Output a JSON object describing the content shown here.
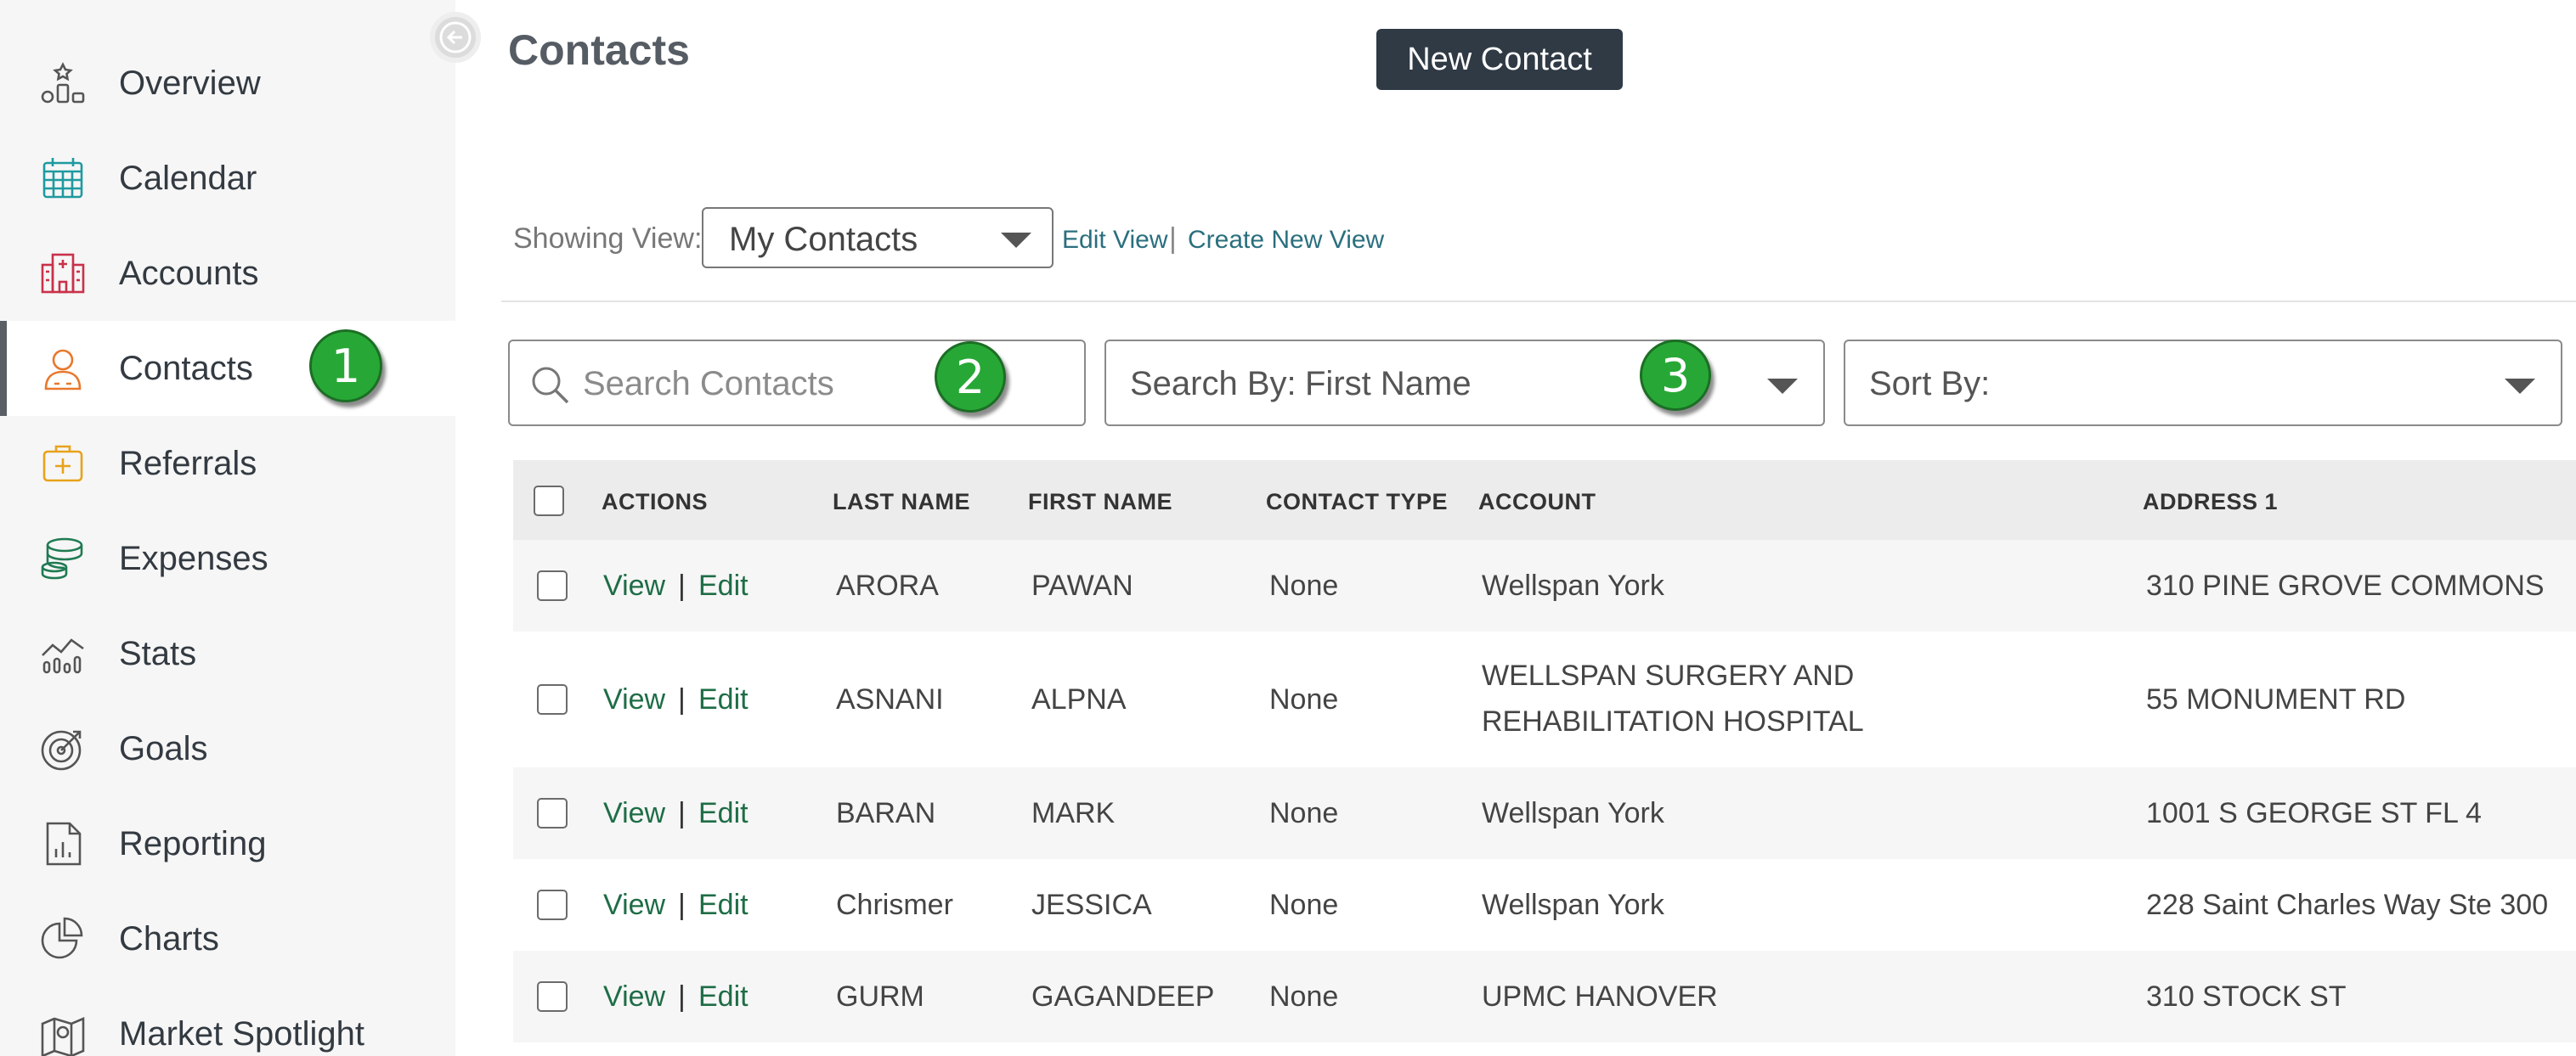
{
  "sidebar": {
    "items": [
      {
        "label": "Overview",
        "icon": "overview-icon"
      },
      {
        "label": "Calendar",
        "icon": "calendar-icon"
      },
      {
        "label": "Accounts",
        "icon": "hospital-icon"
      },
      {
        "label": "Contacts",
        "icon": "person-icon",
        "active": true
      },
      {
        "label": "Referrals",
        "icon": "medkit-icon"
      },
      {
        "label": "Expenses",
        "icon": "coins-icon"
      },
      {
        "label": "Stats",
        "icon": "stats-icon"
      },
      {
        "label": "Goals",
        "icon": "target-icon"
      },
      {
        "label": "Reporting",
        "icon": "report-icon"
      },
      {
        "label": "Charts",
        "icon": "pie-icon"
      },
      {
        "label": "Market Spotlight",
        "icon": "map-icon"
      }
    ]
  },
  "badges": {
    "one": "1",
    "two": "2",
    "three": "3"
  },
  "colors": {
    "accent_green": "#27a836",
    "link": "#1e6d46",
    "dark_button": "#2f3a45"
  },
  "header": {
    "title": "Contacts",
    "new_button": "New Contact"
  },
  "view": {
    "showing_label": "Showing View:",
    "selected": "My Contacts",
    "edit_view": "Edit View",
    "separator": "|",
    "create_view": "Create New View"
  },
  "filters": {
    "search_placeholder": "Search Contacts",
    "search_by_label": "Search By:",
    "search_by_value": "First Name",
    "sort_by_label": "Sort By:"
  },
  "table": {
    "headers": [
      "ACTIONS",
      "LAST NAME",
      "FIRST NAME",
      "CONTACT TYPE",
      "ACCOUNT",
      "ADDRESS 1"
    ],
    "view_label": "View",
    "edit_label": "Edit",
    "pipe": "|",
    "rows": [
      {
        "last": "ARORA",
        "first": "PAWAN",
        "type": "None",
        "account": "Wellspan York",
        "account2": "",
        "address": "310 PINE GROVE COMMONS"
      },
      {
        "last": "ASNANI",
        "first": "ALPNA",
        "type": "None",
        "account": "WELLSPAN SURGERY AND",
        "account2": "REHABILITATION HOSPITAL",
        "address": "55 MONUMENT RD"
      },
      {
        "last": "BARAN",
        "first": "MARK",
        "type": "None",
        "account": "Wellspan York",
        "account2": "",
        "address": "1001 S GEORGE ST FL 4"
      },
      {
        "last": "Chrismer",
        "first": "JESSICA",
        "type": "None",
        "account": "Wellspan York",
        "account2": "",
        "address": "228 Saint Charles Way Ste 300"
      },
      {
        "last": "GURM",
        "first": "GAGANDEEP",
        "type": "None",
        "account": "UPMC HANOVER",
        "account2": "",
        "address": "310 STOCK ST"
      }
    ]
  }
}
